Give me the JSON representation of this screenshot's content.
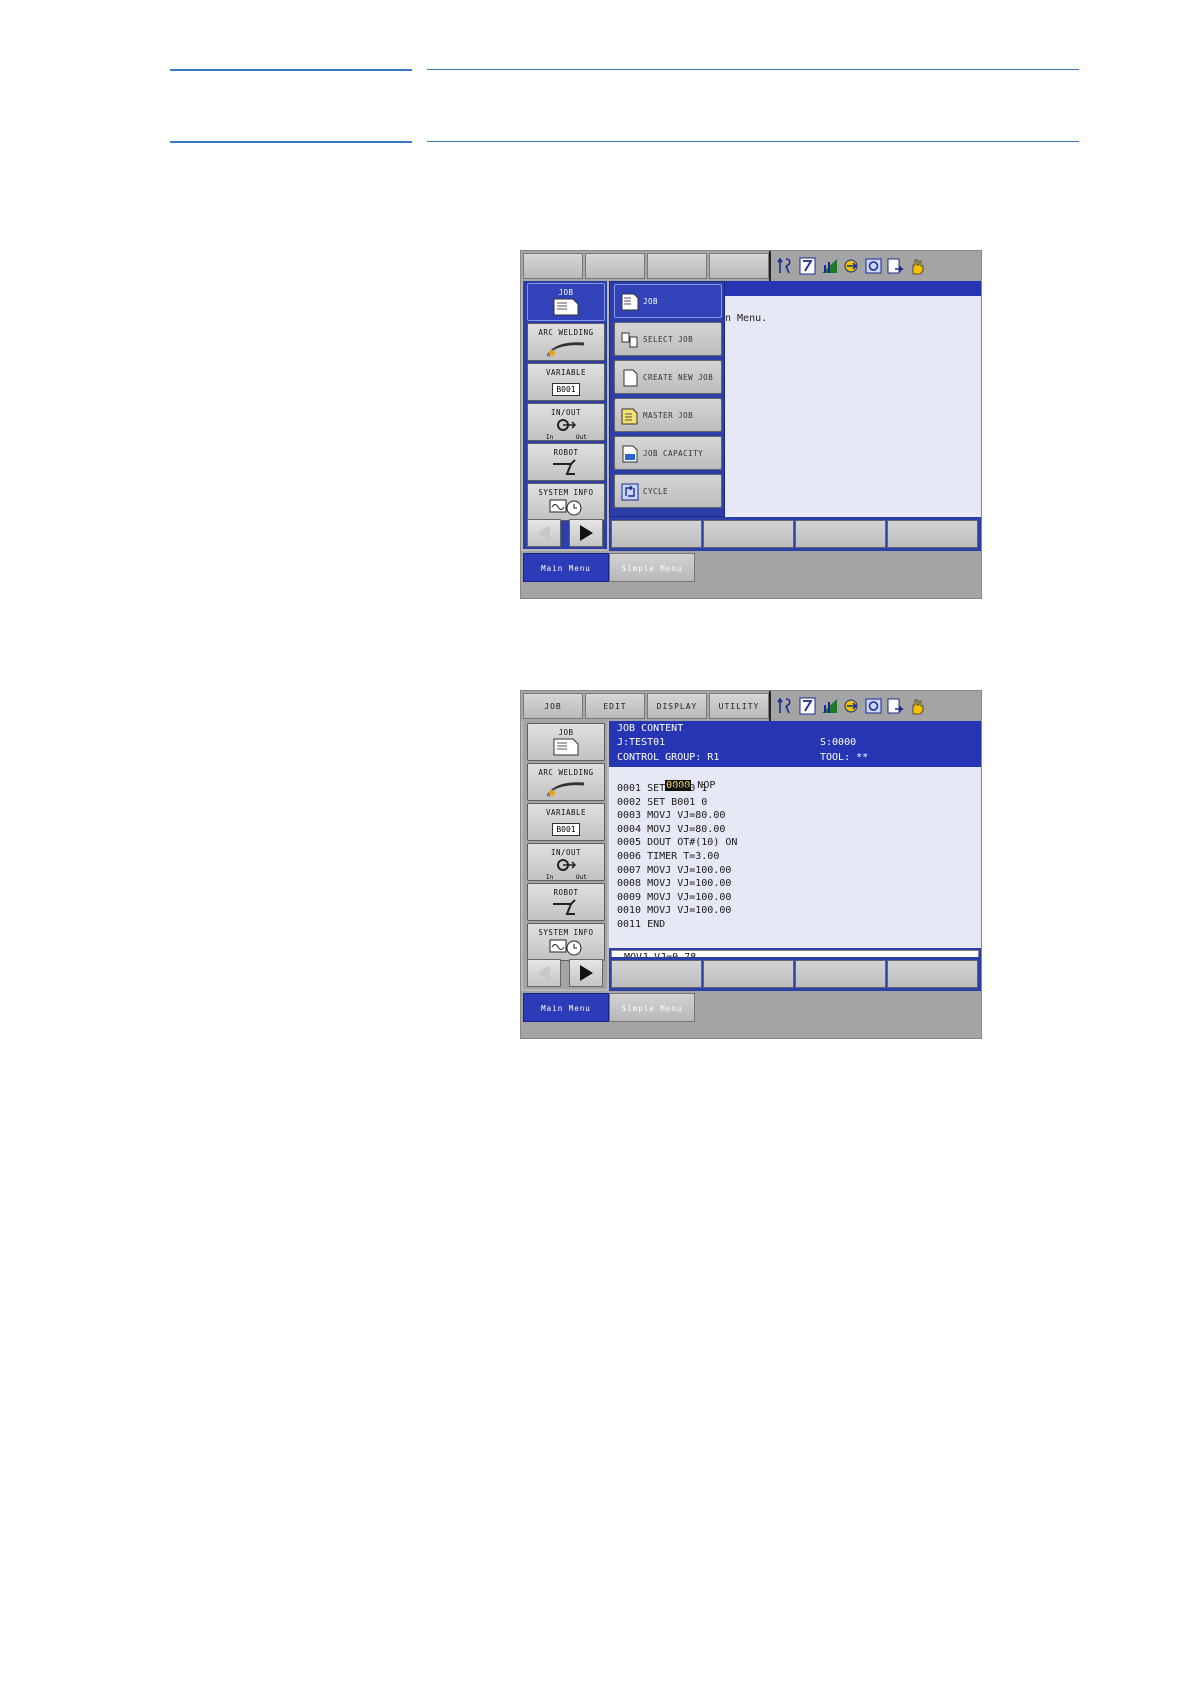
{
  "screen1": {
    "topbar": {
      "buttons": [
        "",
        "",
        "",
        ""
      ]
    },
    "main_menu": [
      {
        "label": "JOB"
      },
      {
        "label": "ARC WELDING"
      },
      {
        "label": "VARIABLE",
        "sub": "B001"
      },
      {
        "label": "IN/OUT",
        "sub_in": "In",
        "sub_out": "Out"
      },
      {
        "label": "ROBOT"
      },
      {
        "label": "SYSTEM INFO"
      }
    ],
    "pulldown": [
      "JOB",
      "SELECT JOB",
      "CREATE NEW JOB",
      "MASTER JOB",
      "JOB CAPACITY",
      "CYCLE"
    ],
    "message": "n Menu.",
    "bottom": {
      "main_menu": "Main Menu",
      "simple_menu": "Simple Menu"
    }
  },
  "screen2": {
    "topbar": {
      "buttons": [
        "JOB",
        "EDIT",
        "DISPLAY",
        "UTILITY"
      ]
    },
    "main_menu": [
      {
        "label": "JOB"
      },
      {
        "label": "ARC WELDING"
      },
      {
        "label": "VARIABLE",
        "sub": "B001"
      },
      {
        "label": "IN/OUT",
        "sub_in": "In",
        "sub_out": "Out"
      },
      {
        "label": "ROBOT"
      },
      {
        "label": "SYSTEM INFO"
      }
    ],
    "job": {
      "title": "JOB CONTENT",
      "name": "J:TEST01",
      "step": "S:0000",
      "control_group": "CONTROL GROUP: R1",
      "tool": "TOOL: **",
      "cursor_line": "0000",
      "first_instruction": "NOP",
      "lines": [
        "0001 SET B000 1",
        "0002 SET B001 0",
        "0003 MOVJ VJ=80.00",
        "0004 MOVJ VJ=80.00",
        "0005 DOUT OT#(10) ON",
        "0006 TIMER T=3.00",
        "0007 MOVJ VJ=100.00",
        "0008 MOVJ VJ=100.00",
        "0009 MOVJ VJ=100.00",
        "0010 MOVJ VJ=100.00",
        "0011 END"
      ],
      "input_buffer": "MOVJ VJ=0.78"
    },
    "bottom": {
      "main_menu": "Main Menu",
      "simple_menu": "Simple Menu"
    }
  },
  "colors": {
    "rule": "#3a78c8",
    "panel_blue": "#2c3fa8",
    "header_blue": "#2535b3",
    "content_bg": "#e6e8f6"
  }
}
